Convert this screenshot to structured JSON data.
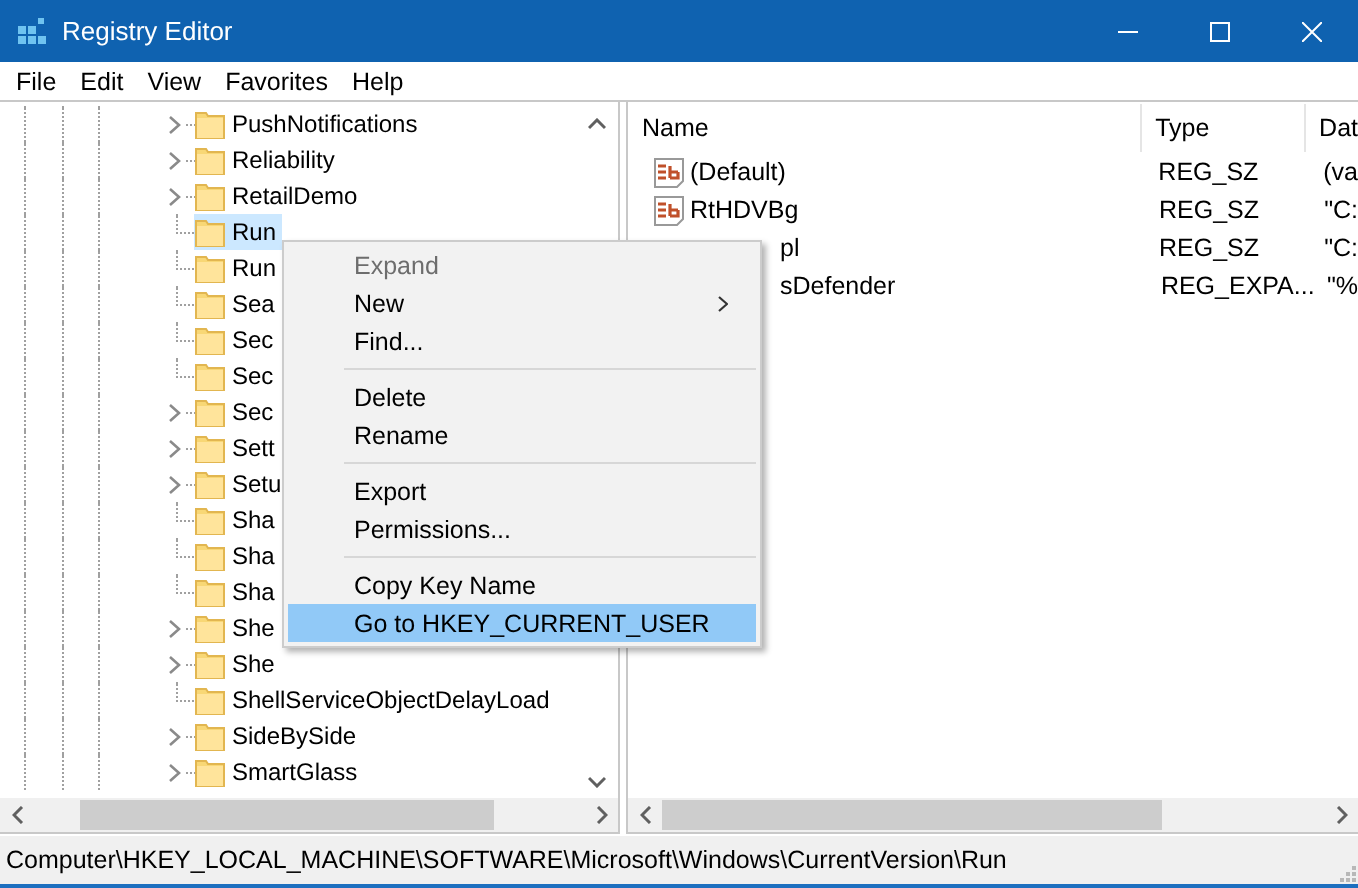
{
  "window": {
    "title": "Registry Editor"
  },
  "menu_bar": [
    "File",
    "Edit",
    "View",
    "Favorites",
    "Help"
  ],
  "tree": {
    "items": [
      {
        "label": "PushNotifications",
        "expandable": true,
        "selected": false
      },
      {
        "label": "Reliability",
        "expandable": true,
        "selected": false
      },
      {
        "label": "RetailDemo",
        "expandable": true,
        "selected": false
      },
      {
        "label": "Run",
        "expandable": false,
        "selected": true
      },
      {
        "label": "Run",
        "expandable": false,
        "selected": false
      },
      {
        "label": "Sea",
        "expandable": false,
        "selected": false
      },
      {
        "label": "Sec",
        "expandable": false,
        "selected": false
      },
      {
        "label": "Sec",
        "expandable": false,
        "selected": false
      },
      {
        "label": "Sec",
        "expandable": true,
        "selected": false
      },
      {
        "label": "Sett",
        "expandable": true,
        "selected": false
      },
      {
        "label": "Setu",
        "expandable": true,
        "selected": false
      },
      {
        "label": "Sha",
        "expandable": false,
        "selected": false
      },
      {
        "label": "Sha",
        "expandable": false,
        "selected": false
      },
      {
        "label": "Sha",
        "expandable": false,
        "selected": false
      },
      {
        "label": "She",
        "expandable": true,
        "selected": false
      },
      {
        "label": "She",
        "expandable": true,
        "selected": false
      },
      {
        "label": "ShellServiceObjectDelayLoad",
        "expandable": false,
        "selected": false
      },
      {
        "label": "SideBySide",
        "expandable": true,
        "selected": false
      },
      {
        "label": "SmartGlass",
        "expandable": true,
        "selected": false
      }
    ]
  },
  "values": {
    "columns": [
      "Name",
      "Type",
      "Dat"
    ],
    "rows": [
      {
        "kind": "full",
        "name": "(Default)",
        "type": "REG_SZ",
        "data": "(va"
      },
      {
        "kind": "full",
        "name": "RtHDVBg",
        "type": "REG_SZ",
        "data": "\"C:"
      },
      {
        "kind": "partial",
        "name": "pl",
        "type": "REG_SZ",
        "data": "\"C:"
      },
      {
        "kind": "partial",
        "name": "sDefender",
        "type": "REG_EXPA...",
        "data": "\"%"
      }
    ]
  },
  "context_menu": [
    {
      "kind": "item",
      "label": "Expand",
      "disabled": true,
      "submenu": false,
      "selected": false
    },
    {
      "kind": "item",
      "label": "New",
      "disabled": false,
      "submenu": true,
      "selected": false
    },
    {
      "kind": "item",
      "label": "Find...",
      "disabled": false,
      "submenu": false,
      "selected": false
    },
    {
      "kind": "separator"
    },
    {
      "kind": "item",
      "label": "Delete",
      "disabled": false,
      "submenu": false,
      "selected": false
    },
    {
      "kind": "item",
      "label": "Rename",
      "disabled": false,
      "submenu": false,
      "selected": false
    },
    {
      "kind": "separator"
    },
    {
      "kind": "item",
      "label": "Export",
      "disabled": false,
      "submenu": false,
      "selected": false
    },
    {
      "kind": "item",
      "label": "Permissions...",
      "disabled": false,
      "submenu": false,
      "selected": false
    },
    {
      "kind": "separator"
    },
    {
      "kind": "item",
      "label": "Copy Key Name",
      "disabled": false,
      "submenu": false,
      "selected": false
    },
    {
      "kind": "item",
      "label": "Go to HKEY_CURRENT_USER",
      "disabled": false,
      "submenu": false,
      "selected": true
    }
  ],
  "status_bar": "Computer\\HKEY_LOCAL_MACHINE\\SOFTWARE\\Microsoft\\Windows\\CurrentVersion\\Run"
}
